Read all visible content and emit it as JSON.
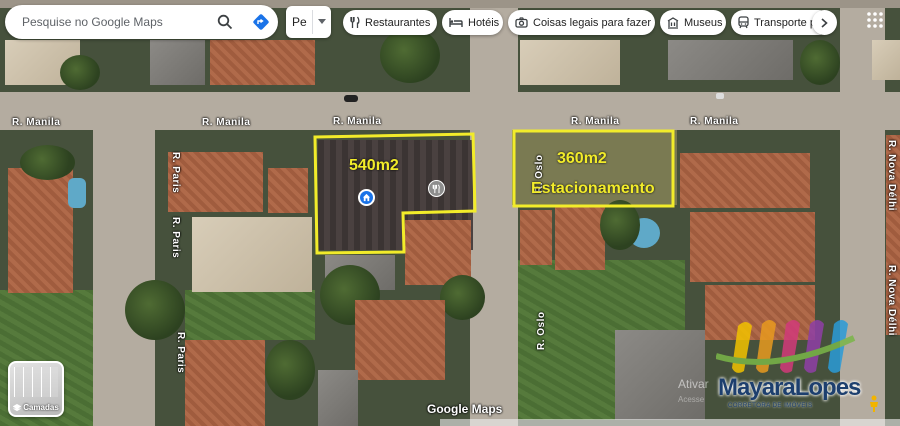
{
  "search": {
    "placeholder": "Pesquise no Google Maps"
  },
  "truncated_input": {
    "text": "Pе"
  },
  "categories": [
    {
      "label": "Restaurantes",
      "icon": "fork-knife-icon"
    },
    {
      "label": "Hotéis",
      "icon": "bed-icon"
    },
    {
      "label": "Coisas legais para fazer",
      "icon": "camera-icon"
    },
    {
      "label": "Museus",
      "icon": "museum-icon"
    },
    {
      "label": "Transporte p",
      "icon": "transit-icon"
    }
  ],
  "streets": {
    "manila_1": "R. Manila",
    "manila_2": "R. Manila",
    "manila_3": "R. Manila",
    "manila_4": "R. Manila",
    "manila_5": "R. Manila",
    "paris_1": "R. Paris",
    "paris_2": "R. Paris",
    "paris_3": "R. Paris",
    "oslo_1": "R. Oslo",
    "oslo_2": "R. Oslo",
    "nova_delhi": "R. Nova Délhi",
    "nova_delhi_2": "R. Nova Délhi"
  },
  "lots": [
    {
      "area": "540m2",
      "color": "#f2ec2a"
    },
    {
      "area": "360m2",
      "note": "Estacionamento",
      "color": "#f2ec2a"
    }
  ],
  "layers_button": {
    "label": "Camadas"
  },
  "attribution": "Google Maps",
  "watermark": {
    "activate_text": "Ativar",
    "activate_sub": "Acesse",
    "brand_name": "MayaraLopes",
    "brand_sub": "CORRETORA DE IMÓVEIS"
  },
  "colors": {
    "lot_outline": "#f2ec2a",
    "road": "#b4aca0"
  }
}
